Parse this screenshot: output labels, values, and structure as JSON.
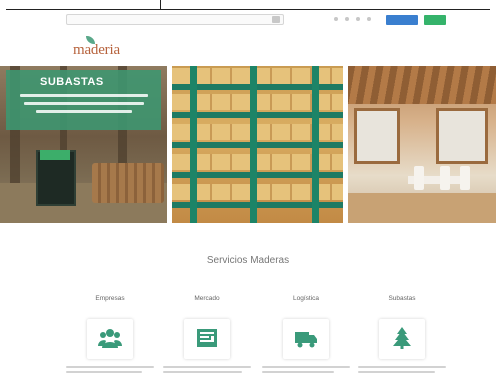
{
  "search": {
    "placeholder": ""
  },
  "topbar": {
    "login_label": "",
    "register_label": ""
  },
  "logo": {
    "text": "maderia"
  },
  "nav": {
    "items": [
      "",
      "",
      "",
      "",
      "",
      "",
      ""
    ]
  },
  "hero": {
    "title": "SUBASTAS",
    "colors": {
      "overlay": "#3e9670",
      "accent_green": "#35b36b",
      "accent_blue": "#3a7fcf",
      "logo_brown": "#b7633d"
    }
  },
  "services": {
    "title": "Servicios Maderas",
    "items": [
      {
        "label": "Empresas",
        "icon": "people-icon"
      },
      {
        "label": "Mercado",
        "icon": "market-icon"
      },
      {
        "label": "Logística",
        "icon": "truck-icon"
      },
      {
        "label": "Subastas",
        "icon": "tree-icon"
      }
    ]
  }
}
